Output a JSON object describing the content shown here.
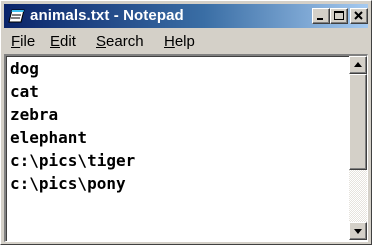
{
  "window": {
    "title": "animals.txt - Notepad",
    "app_icon": "notepad-icon",
    "controls": [
      "minimize-icon",
      "maximize-icon",
      "close-icon"
    ]
  },
  "menu": [
    {
      "label": "File",
      "mnemonic": "F"
    },
    {
      "label": "Edit",
      "mnemonic": "E"
    },
    {
      "label": "Search",
      "mnemonic": "S"
    },
    {
      "label": "Help",
      "mnemonic": "H"
    }
  ],
  "document": {
    "lines": [
      "dog",
      "cat",
      "zebra",
      "elephant",
      "c:\\pics\\tiger",
      "c:\\pics\\pony"
    ]
  },
  "scrollbar": {
    "up_icon": "scroll-up-arrow-icon",
    "down_icon": "scroll-down-arrow-icon"
  },
  "colors": {
    "title_gradient_start": "#0a246a",
    "title_gradient_end": "#a6caf0",
    "chrome": "#d4d0c8"
  }
}
